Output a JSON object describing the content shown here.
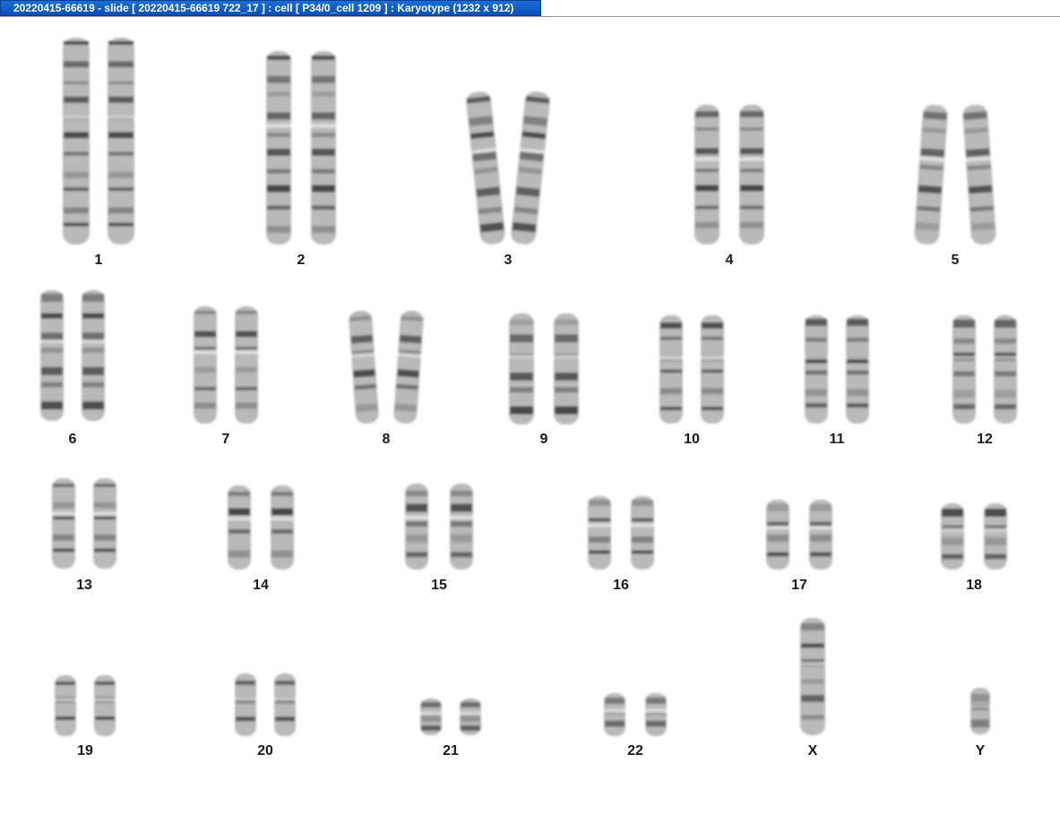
{
  "window": {
    "title": "20220415-66619 - slide [ 20220415-66619 722_17 ] : cell [ P34/0_cell 1209 ] : Karyotype  (1232 x 912)"
  },
  "karyotype": {
    "chromosomes": [
      {
        "label": "1"
      },
      {
        "label": "2"
      },
      {
        "label": "3"
      },
      {
        "label": "4"
      },
      {
        "label": "5"
      },
      {
        "label": "6"
      },
      {
        "label": "7"
      },
      {
        "label": "8"
      },
      {
        "label": "9"
      },
      {
        "label": "10"
      },
      {
        "label": "11"
      },
      {
        "label": "12"
      },
      {
        "label": "13"
      },
      {
        "label": "14"
      },
      {
        "label": "15"
      },
      {
        "label": "16"
      },
      {
        "label": "17"
      },
      {
        "label": "18"
      },
      {
        "label": "19"
      },
      {
        "label": "20"
      },
      {
        "label": "21"
      },
      {
        "label": "22"
      },
      {
        "label": "X"
      },
      {
        "label": "Y"
      }
    ]
  }
}
